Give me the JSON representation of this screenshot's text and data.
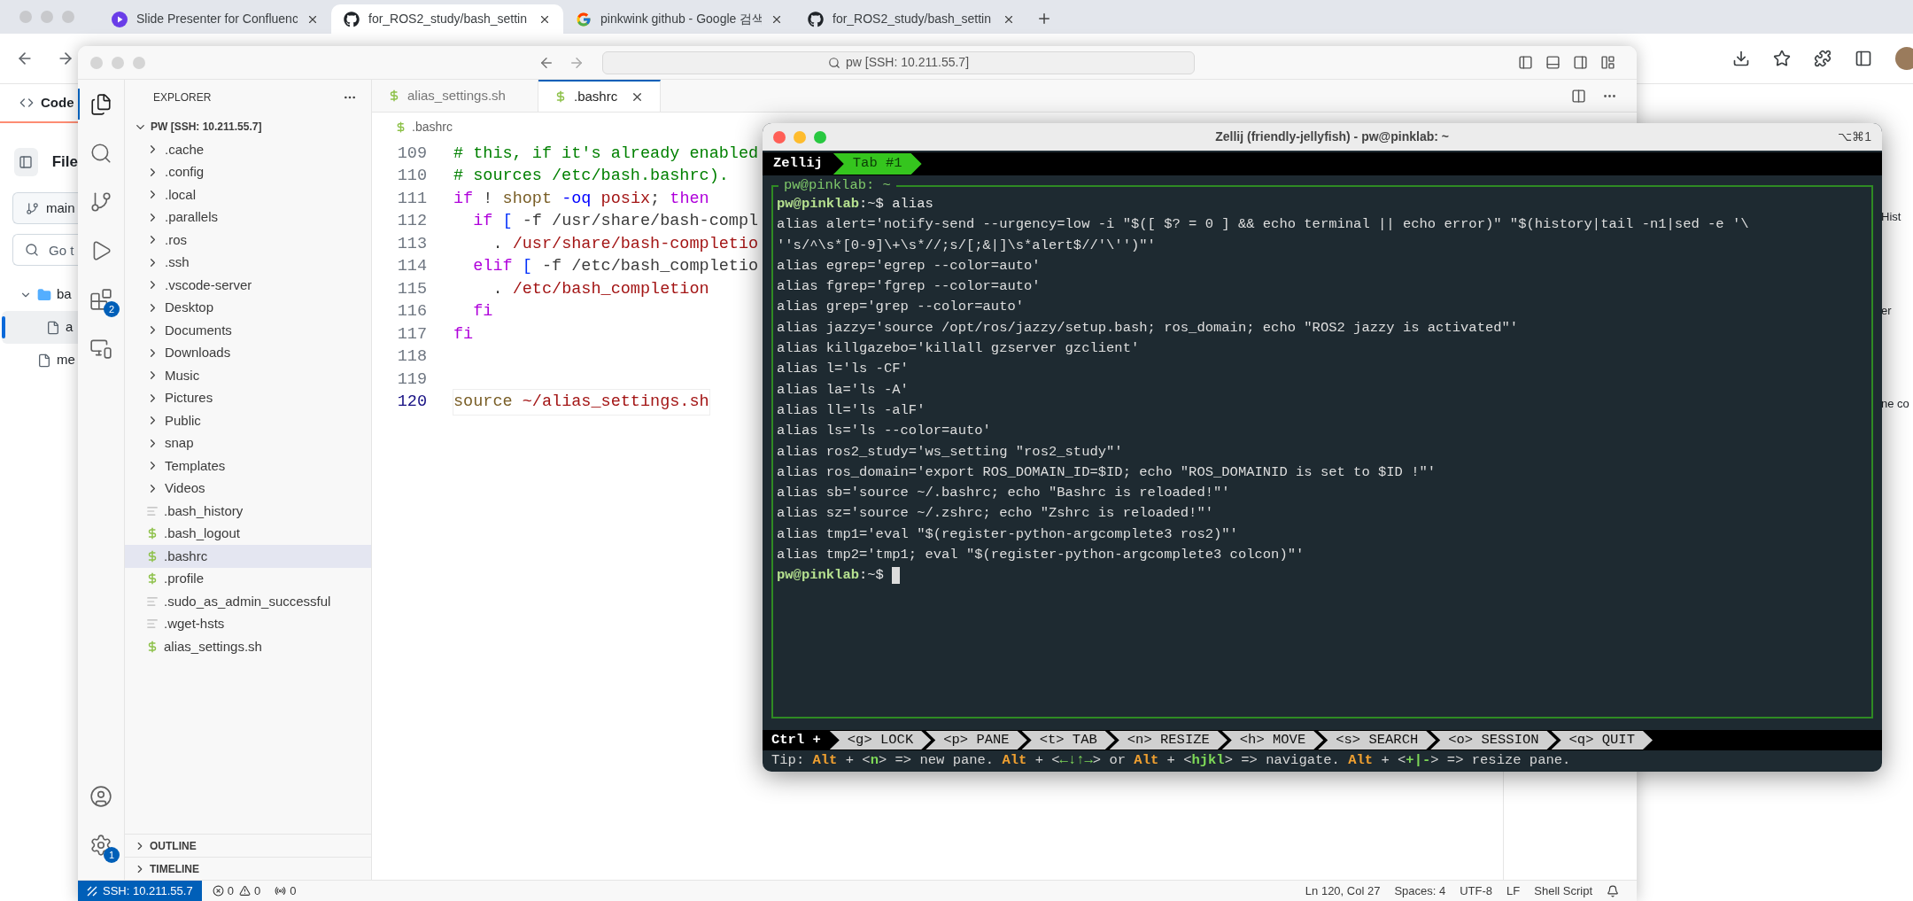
{
  "browser": {
    "tabs": [
      {
        "title": "Slide Presenter for Confluenc",
        "kind": "presenter",
        "selected": false
      },
      {
        "title": "for_ROS2_study/bash_settin",
        "kind": "github",
        "selected": true
      },
      {
        "title": "pinkwink github - Google 검색",
        "kind": "google",
        "selected": false
      },
      {
        "title": "for_ROS2_study/bash_settin",
        "kind": "github",
        "selected": false
      }
    ]
  },
  "github_page": {
    "code_tab": "Code",
    "file_header": "File",
    "branch": "main",
    "search_placeholder": "Go t",
    "tree": [
      {
        "label": "ba",
        "kind": "folder",
        "selected": false,
        "children": [
          {
            "label": "a",
            "kind": "file",
            "selected": true
          }
        ]
      },
      {
        "label": "me",
        "kind": "file",
        "selected": false
      }
    ],
    "right_fragments": [
      "Hist",
      "er",
      "ne co"
    ]
  },
  "vscode": {
    "command_center": "pw [SSH: 10.211.55.7]",
    "activity": [
      {
        "kind": "explorer",
        "selected": true
      },
      {
        "kind": "search",
        "selected": false
      },
      {
        "kind": "source-control",
        "selected": false
      },
      {
        "kind": "run",
        "selected": false
      },
      {
        "kind": "extensions",
        "selected": false,
        "badge": "2"
      },
      {
        "kind": "remote",
        "selected": false
      }
    ],
    "activity_bottom": [
      {
        "kind": "accounts"
      },
      {
        "kind": "manage",
        "badge": "1"
      }
    ],
    "explorer": {
      "title": "EXPLORER",
      "root": "PW [SSH: 10.211.55.7]",
      "items": [
        {
          "label": ".cache",
          "kind": "folder",
          "selected": false
        },
        {
          "label": ".config",
          "kind": "folder",
          "selected": false
        },
        {
          "label": ".local",
          "kind": "folder",
          "selected": false
        },
        {
          "label": ".parallels",
          "kind": "folder",
          "selected": false
        },
        {
          "label": ".ros",
          "kind": "folder",
          "selected": false
        },
        {
          "label": ".ssh",
          "kind": "folder",
          "selected": false
        },
        {
          "label": ".vscode-server",
          "kind": "folder",
          "selected": false
        },
        {
          "label": "Desktop",
          "kind": "folder",
          "selected": false
        },
        {
          "label": "Documents",
          "kind": "folder",
          "selected": false
        },
        {
          "label": "Downloads",
          "kind": "folder",
          "selected": false
        },
        {
          "label": "Music",
          "kind": "folder",
          "selected": false
        },
        {
          "label": "Pictures",
          "kind": "folder",
          "selected": false
        },
        {
          "label": "Public",
          "kind": "folder",
          "selected": false
        },
        {
          "label": "snap",
          "kind": "folder",
          "selected": false
        },
        {
          "label": "Templates",
          "kind": "folder",
          "selected": false
        },
        {
          "label": "Videos",
          "kind": "folder",
          "selected": false
        },
        {
          "label": ".bash_history",
          "kind": "text",
          "selected": false
        },
        {
          "label": ".bash_logout",
          "kind": "shell",
          "selected": false
        },
        {
          "label": ".bashrc",
          "kind": "shell",
          "selected": true
        },
        {
          "label": ".profile",
          "kind": "shell",
          "selected": false
        },
        {
          "label": ".sudo_as_admin_successful",
          "kind": "text",
          "selected": false
        },
        {
          "label": ".wget-hsts",
          "kind": "text",
          "selected": false
        },
        {
          "label": "alias_settings.sh",
          "kind": "shell",
          "selected": false
        }
      ],
      "sections": [
        "OUTLINE",
        "TIMELINE"
      ]
    },
    "editor_tabs": [
      {
        "label": "alias_settings.sh",
        "selected": false
      },
      {
        "label": ".bashrc",
        "selected": true
      }
    ],
    "breadcrumb": ".bashrc",
    "lines": [
      {
        "number": "109",
        "current": false,
        "tokens": [
          {
            "kind": "comment",
            "text": "# this, if it's already enabled"
          }
        ]
      },
      {
        "number": "110",
        "current": false,
        "tokens": [
          {
            "kind": "comment",
            "text": "# sources /etc/bash.bashrc)."
          }
        ]
      },
      {
        "number": "111",
        "current": false,
        "tokens": [
          {
            "kind": "keyword",
            "text": "if"
          },
          {
            "kind": "plain",
            "text": " ! "
          },
          {
            "kind": "command",
            "text": "shopt "
          },
          {
            "kind": "flag",
            "text": "-oq "
          },
          {
            "kind": "path",
            "text": "posix"
          },
          {
            "kind": "plain",
            "text": "; "
          },
          {
            "kind": "keyword",
            "text": "then"
          }
        ]
      },
      {
        "number": "112",
        "current": false,
        "tokens": [
          {
            "kind": "keyword",
            "text": "  if "
          },
          {
            "kind": "bracket",
            "text": "["
          },
          {
            "kind": "plain",
            "text": " -f /usr/share/bash-compl"
          }
        ]
      },
      {
        "number": "113",
        "current": false,
        "tokens": [
          {
            "kind": "plain",
            "text": "    . "
          },
          {
            "kind": "path",
            "text": "/usr/share/bash-completio"
          }
        ]
      },
      {
        "number": "114",
        "current": false,
        "tokens": [
          {
            "kind": "keyword",
            "text": "  elif "
          },
          {
            "kind": "bracket",
            "text": "["
          },
          {
            "kind": "plain",
            "text": " -f /etc/bash_completio"
          }
        ]
      },
      {
        "number": "115",
        "current": false,
        "tokens": [
          {
            "kind": "plain",
            "text": "    . "
          },
          {
            "kind": "path",
            "text": "/etc/bash_completion"
          }
        ]
      },
      {
        "number": "116",
        "current": false,
        "tokens": [
          {
            "kind": "keyword",
            "text": "  fi"
          }
        ]
      },
      {
        "number": "117",
        "current": false,
        "tokens": [
          {
            "kind": "keyword",
            "text": "fi"
          }
        ]
      },
      {
        "number": "118",
        "current": false
      },
      {
        "number": "119",
        "current": false
      },
      {
        "number": "120",
        "current": true,
        "tokens": [
          {
            "kind": "command",
            "text": "source "
          },
          {
            "kind": "path",
            "text": "~/alias_settings.sh"
          }
        ]
      }
    ],
    "status_bar": {
      "remote": "SSH: 10.211.55.7",
      "errors": "0",
      "warnings": "0",
      "ports": "0",
      "right": [
        "Ln 120, Col 27",
        "Spaces: 4",
        "UTF-8",
        "LF",
        "Shell Script"
      ]
    }
  },
  "terminal": {
    "title": "Zellij (friendly-jellyfish) - pw@pinklab: ~",
    "shortcut": "⌥⌘1",
    "session": "Zellij",
    "tabs": [
      {
        "label": "Tab #1",
        "selected": true
      }
    ],
    "pane_title": "pw@pinklab: ~",
    "lines": [
      {
        "kind": "prompt",
        "prompt": "pw@pinklab",
        "path": ":~$",
        "command": " alias",
        "cursor": false
      },
      {
        "kind": "output",
        "text": "alias alert='notify-send --urgency=low -i \"$([ $? = 0 ] && echo terminal || echo error)\" \"$(history|tail -n1|sed -e '\\"
      },
      {
        "kind": "output",
        "text": "''s/^\\s*[0-9]\\+\\s*//;s/[;&|]\\s*alert$//'\\'')\"'"
      },
      {
        "kind": "output",
        "text": "alias egrep='egrep --color=auto'"
      },
      {
        "kind": "output",
        "text": "alias fgrep='fgrep --color=auto'"
      },
      {
        "kind": "output",
        "text": "alias grep='grep --color=auto'"
      },
      {
        "kind": "output",
        "text": "alias jazzy='source /opt/ros/jazzy/setup.bash; ros_domain; echo \"ROS2 jazzy is activated\"'"
      },
      {
        "kind": "output",
        "text": "alias killgazebo='killall gzserver gzclient'"
      },
      {
        "kind": "output",
        "text": "alias l='ls -CF'"
      },
      {
        "kind": "output",
        "text": "alias la='ls -A'"
      },
      {
        "kind": "output",
        "text": "alias ll='ls -alF'"
      },
      {
        "kind": "output",
        "text": "alias ls='ls --color=auto'"
      },
      {
        "kind": "output",
        "text": "alias ros2_study='ws_setting \"ros2_study\"'"
      },
      {
        "kind": "output",
        "text": "alias ros_domain='export ROS_DOMAIN_ID=$ID; echo \"ROS_DOMAINID is set to $ID !\"'"
      },
      {
        "kind": "output",
        "text": "alias sb='source ~/.bashrc; echo \"Bashrc is reloaded!\"'"
      },
      {
        "kind": "output",
        "text": "alias sz='source ~/.zshrc; echo \"Zshrc is reloaded!\"'"
      },
      {
        "kind": "output",
        "text": "alias tmp1='eval \"$(register-python-argcomplete3 ros2)\"'"
      },
      {
        "kind": "output",
        "text": "alias tmp2='tmp1; eval \"$(register-python-argcomplete3 colcon)\"'"
      },
      {
        "kind": "prompt",
        "prompt": "pw@pinklab",
        "path": ":~$",
        "cursor": true
      }
    ],
    "keybar": {
      "modifier": "Ctrl +",
      "keys": [
        "<g> LOCK",
        "<p> PANE",
        "<t> TAB",
        "<n> RESIZE",
        "<h> MOVE",
        "<s> SEARCH",
        "<o> SESSION",
        "<q> QUIT"
      ]
    },
    "tip": [
      {
        "kind": "plain",
        "text": "Tip: "
      },
      {
        "kind": "modifier",
        "text": "Alt"
      },
      {
        "kind": "plain",
        "text": " + <"
      },
      {
        "kind": "key",
        "text": "n"
      },
      {
        "kind": "plain",
        "text": "> => new pane. "
      },
      {
        "kind": "modifier",
        "text": "Alt"
      },
      {
        "kind": "plain",
        "text": " + <"
      },
      {
        "kind": "key",
        "text": "←↓↑→"
      },
      {
        "kind": "plain",
        "text": "> or "
      },
      {
        "kind": "modifier",
        "text": "Alt"
      },
      {
        "kind": "plain",
        "text": " + <"
      },
      {
        "kind": "key",
        "text": "hjkl"
      },
      {
        "kind": "plain",
        "text": "> => navigate. "
      },
      {
        "kind": "modifier",
        "text": "Alt"
      },
      {
        "kind": "plain",
        "text": " + <"
      },
      {
        "kind": "key",
        "text": "+|-"
      },
      {
        "kind": "plain",
        "text": "> => resize pane."
      }
    ]
  }
}
